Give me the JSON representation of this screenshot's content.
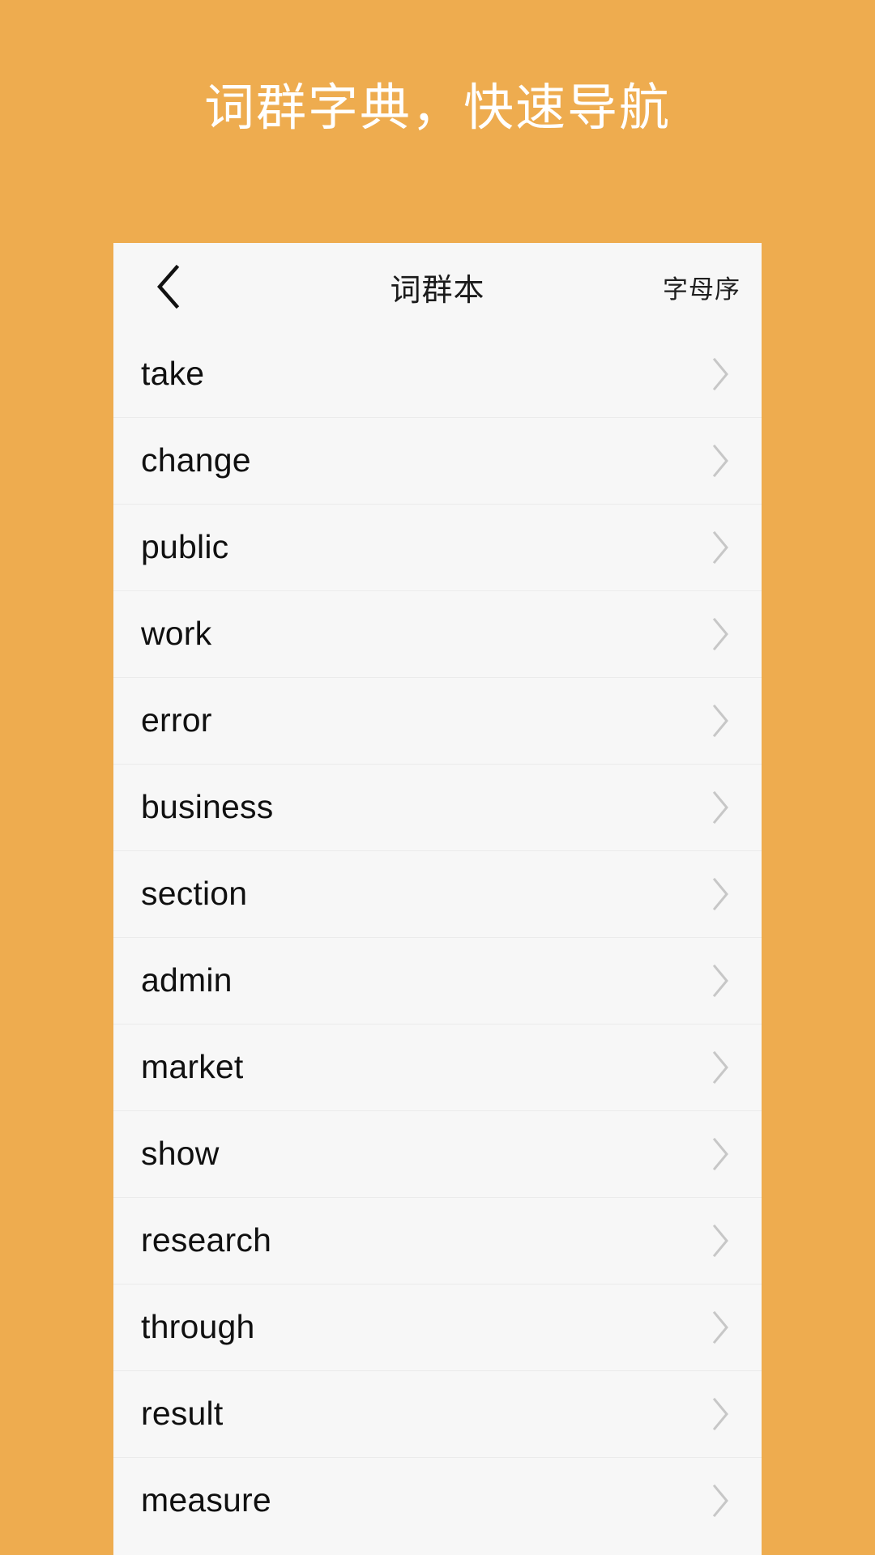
{
  "promo": {
    "headline": "词群字典，快速导航"
  },
  "colors": {
    "background": "#eeac4f",
    "card": "#f7f7f7",
    "divider": "#ebebeb",
    "text": "#101010",
    "chevron": "#c7c7c7"
  },
  "navbar": {
    "back_icon": "chevron-left-icon",
    "title": "词群本",
    "action_label": "字母序"
  },
  "list": {
    "chevron_icon": "chevron-right-icon",
    "items": [
      {
        "label": "take"
      },
      {
        "label": "change"
      },
      {
        "label": "public"
      },
      {
        "label": "work"
      },
      {
        "label": "error"
      },
      {
        "label": "business"
      },
      {
        "label": "section"
      },
      {
        "label": "admin"
      },
      {
        "label": "market"
      },
      {
        "label": "show"
      },
      {
        "label": "research"
      },
      {
        "label": "through"
      },
      {
        "label": "result"
      },
      {
        "label": "measure"
      }
    ]
  }
}
